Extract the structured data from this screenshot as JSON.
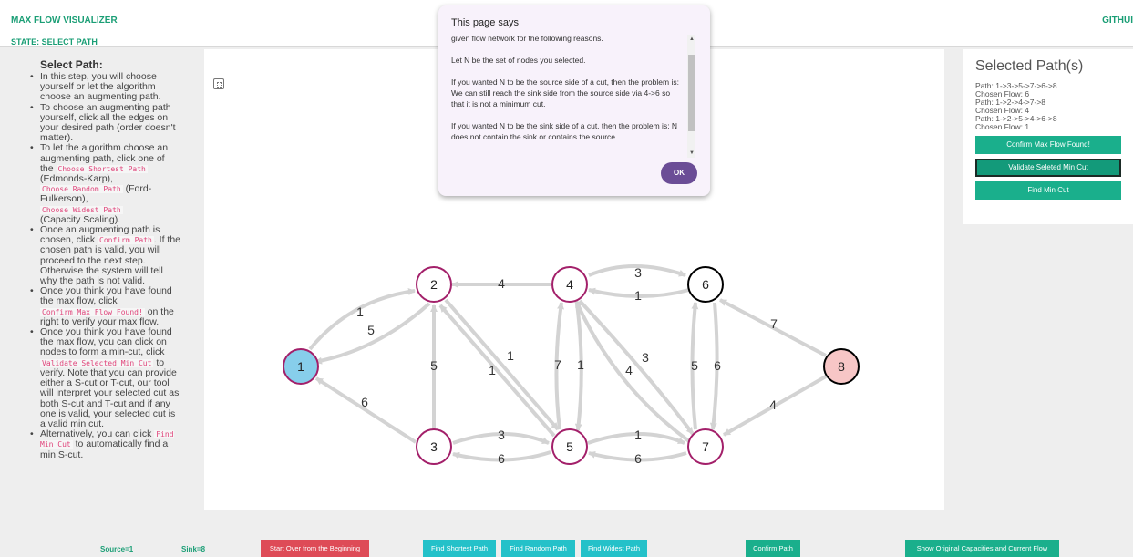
{
  "header": {
    "title": "MAX FLOW VISUALIZER",
    "state": "STATE: SELECT PATH",
    "github": "GITHUI"
  },
  "instructions": {
    "heading": "Select Path:",
    "items": [
      "In this step, you will choose yourself or let the algorithm choose an augmenting path.",
      "To choose an augmenting path yourself, click all the edges on your desired path (order doesn't matter).",
      "To let the algorithm choose an augmenting path, click one of the",
      "Once an augmenting path is chosen, click",
      "Once you think you have found the max flow, click",
      "Once you think you have found the max flow, you can click on nodes to form a min-cut, click",
      "Alternatively, you can click"
    ],
    "code_shortest": "Choose Shortest Path",
    "text_edmonds": "(Edmonds-Karp),",
    "code_random": "Choose Random Path",
    "text_ford": "(Ford-Fulkerson),",
    "code_widest": "Choose Widest Path",
    "text_capacity": "(Capacity Scaling).",
    "code_confirm": "Confirm Path",
    "text_confirm_after": ". If the chosen path is valid, you will proceed to the next step. Otherwise the system will tell why the path is not valid.",
    "code_maxflow": "Confirm Max Flow Found!",
    "text_maxflow_after": "on the right to verify your max flow.",
    "code_mincut": "Validate Selected Min Cut",
    "text_mincut_after": "to verify. Note that you can provide either a S-cut or T-cut, our tool will interpret your selected cut as both S-cut and T-cut and if any one is valid, your selected cut is a valid min cut.",
    "code_findmin": "Find Min Cut",
    "text_findmin_after": "to automatically find a min S-cut."
  },
  "graph": {
    "nodes": [
      {
        "id": "1",
        "state": "source"
      },
      {
        "id": "2",
        "state": "normal"
      },
      {
        "id": "3",
        "state": "normal"
      },
      {
        "id": "4",
        "state": "normal"
      },
      {
        "id": "5",
        "state": "normal"
      },
      {
        "id": "6",
        "state": "black"
      },
      {
        "id": "7",
        "state": "normal"
      },
      {
        "id": "8",
        "state": "sink"
      }
    ],
    "edge_labels": [
      "1",
      "5",
      "6",
      "4",
      "5",
      "1",
      "1",
      "7",
      "1",
      "3",
      "1",
      "3",
      "4",
      "5",
      "6",
      "7",
      "4",
      "3",
      "6",
      "1",
      "6"
    ],
    "colors": {
      "node_border": "#a3206a",
      "source_fill": "#87ceeb",
      "sink_fill": "#f7c6c6",
      "edge": "#d3d3d3",
      "black_border": "#000000"
    }
  },
  "selected_paths": {
    "title": "Selected Path(s)",
    "lines": [
      "Path: 1->3->5->7->6->8",
      "Chosen Flow: 6",
      "Path: 1->2->4->7->8",
      "Chosen Flow: 4",
      "Path: 1->2->5->4->6->8",
      "Chosen Flow: 1"
    ],
    "btn_confirm_max": "Confirm Max Flow Found!",
    "btn_validate": "Validate Seleted Min Cut",
    "btn_find_min": "Find Min Cut"
  },
  "bottom": {
    "source": "Source=1",
    "sink": "Sink=8",
    "start_over": "Start Over from the Beginning",
    "find_shortest": "Find Shortest Path",
    "find_random": "Find Random Path",
    "find_widest": "Find Widest Path",
    "confirm_path": "Confirm Path",
    "show_original": "Show Original Capacities and Current Flow"
  },
  "dialog": {
    "title": "This page says",
    "paragraphs": [
      "given flow network for the following reasons.",
      "Let N be the set of nodes you selected.",
      "If you wanted N to be the source side of a cut, then the problem is: We can still reach the sink side from the source side via 4->6 so that it is not a minimum cut.",
      "If you wanted N to be the sink side of a cut, then the problem is: N does not contain the sink or contains the source."
    ],
    "ok": "OK"
  }
}
